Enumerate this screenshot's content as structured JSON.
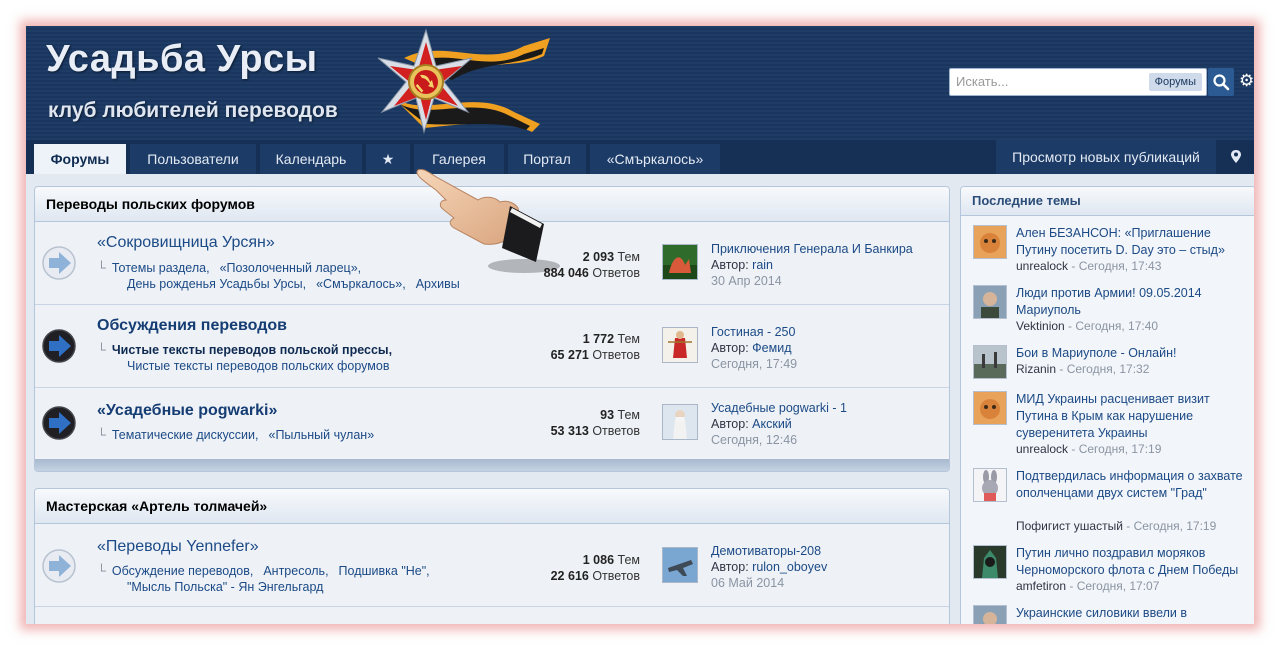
{
  "header": {
    "title": "Усадьба Урсы",
    "subtitle": "клуб любителей переводов",
    "search": {
      "placeholder": "Искать...",
      "scope": "Форумы"
    },
    "icons": {
      "search": "search-icon",
      "settings": "gear-icon",
      "emblem": "victory-order-emblem"
    }
  },
  "nav": {
    "tabs": [
      "Форумы",
      "Пользователи",
      "Календарь",
      "★",
      "Галерея",
      "Портал",
      "«Смъркалось»"
    ],
    "active_tab": "Форумы",
    "new_posts": "Просмотр новых публикаций",
    "location_icon": "map-pin-icon"
  },
  "categories": [
    {
      "name": "Переводы польских форумов",
      "forums": [
        {
          "title": "«Сокровищница Урсян»",
          "icon_state": "read",
          "subforums": [
            "Тотемы раздела,",
            "«Позолоченный ларец»,",
            "День рожденья Усадьбы Урсы,",
            "«Смъркалось»,",
            "Архивы"
          ],
          "topics_count": "2 093",
          "topics_label": "Тем",
          "replies_count": "884 046",
          "replies_label": "Ответов",
          "last_title": "Приключения Генерала И Банкира",
          "last_author_label": "Автор:",
          "last_author": "rain",
          "last_date": "30 Апр 2014"
        },
        {
          "title": "Обсуждения переводов",
          "icon_state": "unread",
          "subforums": [
            "Чистые тексты переводов польской прессы,",
            "Чистые тексты переводов польских форумов"
          ],
          "topics_count": "1 772",
          "topics_label": "Тем",
          "replies_count": "65 271",
          "replies_label": "Ответов",
          "last_title": "Гостиная - 250",
          "last_author_label": "Автор:",
          "last_author": "Фемид",
          "last_date": "Сегодня, 17:49"
        },
        {
          "title": "«Усадебные pogwarki»",
          "icon_state": "unread",
          "subforums": [
            "Тематические дискуссии,",
            "«Пыльный чулан»"
          ],
          "topics_count": "93",
          "topics_label": "Тем",
          "replies_count": "53 313",
          "replies_label": "Ответов",
          "last_title": "Усадебные pogwarki - 1",
          "last_author_label": "Автор:",
          "last_author": "Акский",
          "last_date": "Сегодня, 12:46"
        }
      ]
    },
    {
      "name": "Мастерская «Артель толмачей»",
      "forums": [
        {
          "title": "«Переводы Yennefer»",
          "icon_state": "read",
          "subforums": [
            "Обсуждение переводов,",
            "Антресоль,",
            "Подшивка \"Не\",",
            "\"Мысль Польска\" - Ян Энгельгард"
          ],
          "topics_count": "1 086",
          "topics_label": "Тем",
          "replies_count": "22 616",
          "replies_label": "Ответов",
          "last_title": "Демотиваторы-208",
          "last_author_label": "Автор:",
          "last_author": "rulon_oboyev",
          "last_date": "06 Май 2014"
        }
      ]
    }
  ],
  "sidebar": {
    "title": "Последние темы",
    "topics": [
      {
        "title": "Ален БЕЗАНСОН: «Приглашение Путину посетить D. Day это – стыд»",
        "author": "unrealock",
        "date": "Сегодня, 17:43"
      },
      {
        "title": "Люди против Армии! 09.05.2014 Мариуполь",
        "author": "Vektinion",
        "date": "Сегодня, 17:40"
      },
      {
        "title": "Бои в Мариуполе - Онлайн!",
        "author": "Rizanin",
        "date": "Сегодня, 17:32"
      },
      {
        "title": "МИД Украины расценивает визит Путина в Крым как нарушение суверенитета Украины",
        "author": "unrealock",
        "date": "Сегодня, 17:19"
      },
      {
        "title": "Подтвердилась информация о захвате ополченцами двух систем \"Град\"",
        "author": "Пофигист ушастый",
        "date": "Сегодня, 17:19"
      },
      {
        "title": "Путин лично поздравил моряков Черноморского флота с Днем Победы",
        "author": "amfetiron",
        "date": "Сегодня, 17:07"
      },
      {
        "title": "Украинские силовики ввели в",
        "author": "",
        "date": ""
      }
    ],
    "meta_separator": " - "
  },
  "colors": {
    "header_bg": "#1e3c66",
    "nav_bg": "#152f55",
    "link": "#1c4a86",
    "active_tab_bg": "#eef3f9",
    "frame_glow": "#e67878"
  }
}
